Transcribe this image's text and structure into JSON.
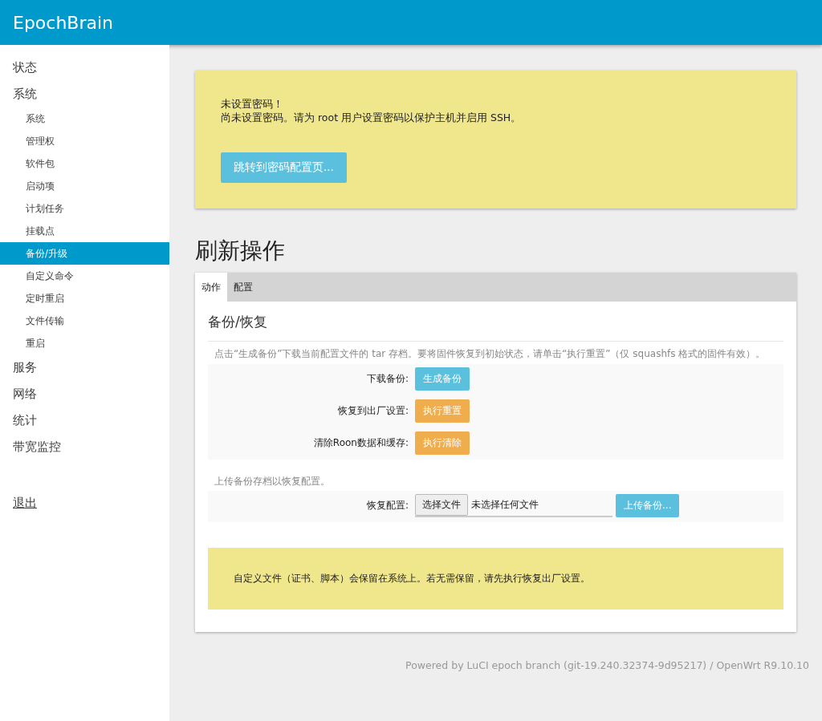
{
  "header": {
    "title": "EpochBrain"
  },
  "sidebar": {
    "items": [
      {
        "label": "状态",
        "selected": false
      },
      {
        "label": "系统",
        "selected": false,
        "children": [
          {
            "label": "系统",
            "selected": false
          },
          {
            "label": "管理权",
            "selected": false
          },
          {
            "label": "软件包",
            "selected": false
          },
          {
            "label": "启动项",
            "selected": false
          },
          {
            "label": "计划任务",
            "selected": false
          },
          {
            "label": "挂载点",
            "selected": false
          },
          {
            "label": "备份/升级",
            "selected": true
          },
          {
            "label": "自定义命令",
            "selected": false
          },
          {
            "label": "定时重启",
            "selected": false
          },
          {
            "label": "文件传输",
            "selected": false
          },
          {
            "label": "重启",
            "selected": false
          }
        ]
      },
      {
        "label": "服务",
        "selected": false
      },
      {
        "label": "网络",
        "selected": false
      },
      {
        "label": "统计",
        "selected": false
      },
      {
        "label": "带宽监控",
        "selected": false
      }
    ],
    "logout": "退出"
  },
  "alert": {
    "title": "未设置密码！",
    "message": "尚未设置密码。请为 root 用户设置密码以保护主机并启用 SSH。",
    "button": "跳转到密码配置页..."
  },
  "page_title": "刷新操作",
  "tabs": [
    {
      "label": "动作",
      "selected": true
    },
    {
      "label": "配置",
      "selected": false
    }
  ],
  "section": {
    "title": "备份/恢复",
    "description": "点击“生成备份”下载当前配置文件的 tar 存档。要将固件恢复到初始状态，请单击“执行重置”（仅 squashfs 格式的固件有效）。",
    "actions": [
      {
        "label": "下载备份:",
        "button": "生成备份",
        "kind": "info"
      },
      {
        "label": "恢复到出厂设置:",
        "button": "执行重置",
        "kind": "warning"
      },
      {
        "label": "清除Roon数据和缓存:",
        "button": "执行清除",
        "kind": "warning"
      }
    ],
    "upload_description": "上传备份存档以恢复配置。",
    "restore": {
      "label": "恢复配置:",
      "choose_button": "选择文件",
      "file_status": "未选择任何文件",
      "upload_button": "上传备份..."
    },
    "note": "自定义文件（证书、脚本）会保留在系统上。若无需保留，请先执行恢复出厂设置。"
  },
  "footer": "Powered by LuCI epoch branch (git-19.240.32374-9d95217) / OpenWrt R9.10.10"
}
